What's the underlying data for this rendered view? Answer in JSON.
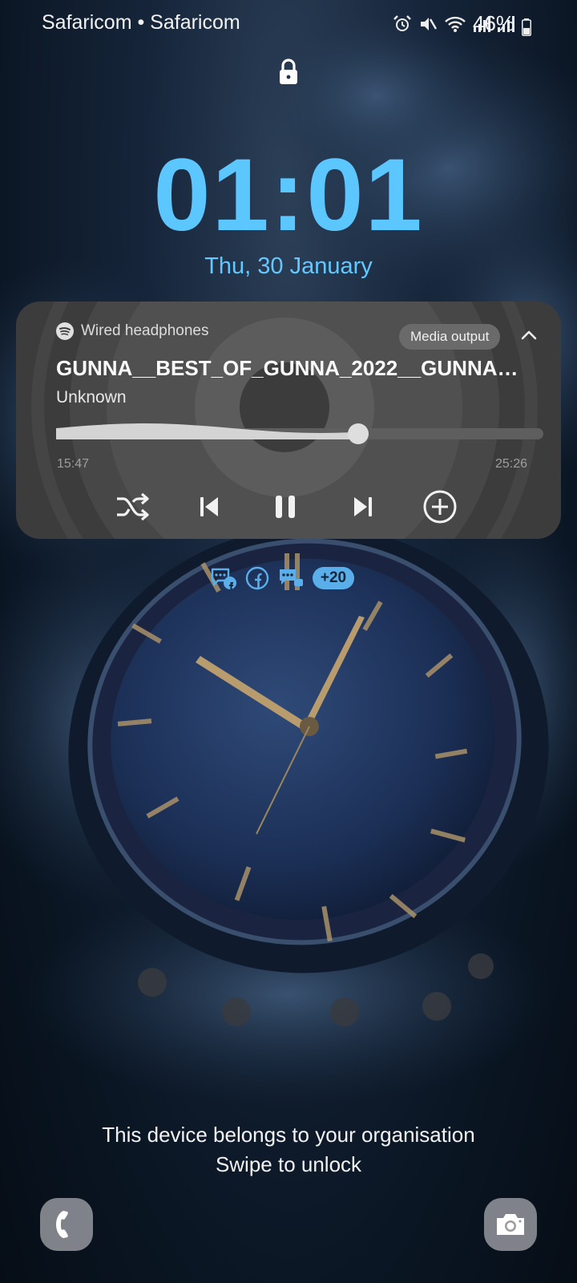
{
  "status_bar": {
    "carrier": "Safaricom • Safaricom",
    "battery_percent": "46%",
    "battery_level": 0.46,
    "icons": [
      "alarm-icon",
      "mute-icon",
      "wifi-icon",
      "signal-icon",
      "signal-icon",
      "battery-icon"
    ]
  },
  "lock_screen": {
    "time": "01:01",
    "date": "Thu, 30 January",
    "accent_color": "#5cc6ff"
  },
  "media_player": {
    "app_icon": "spotify-icon",
    "source": "Wired headphones",
    "output_button": "Media output",
    "title": "GUNNA__BEST_OF_GUNNA_2022__GUNNA…",
    "artist": "Unknown",
    "elapsed": "15:47",
    "duration": "25:26",
    "progress": 0.62,
    "controls": [
      "shuffle-icon",
      "previous-icon",
      "pause-icon",
      "next-icon",
      "add-icon"
    ]
  },
  "notifications": {
    "icons": [
      "messenger-facebook-icon",
      "facebook-icon",
      "messenger-icon"
    ],
    "more_count": "+20"
  },
  "footer": {
    "organisation_message": "This device belongs to your organisation",
    "unlock_hint": "Swipe to unlock"
  },
  "shortcuts": [
    "phone-icon",
    "camera-icon"
  ]
}
